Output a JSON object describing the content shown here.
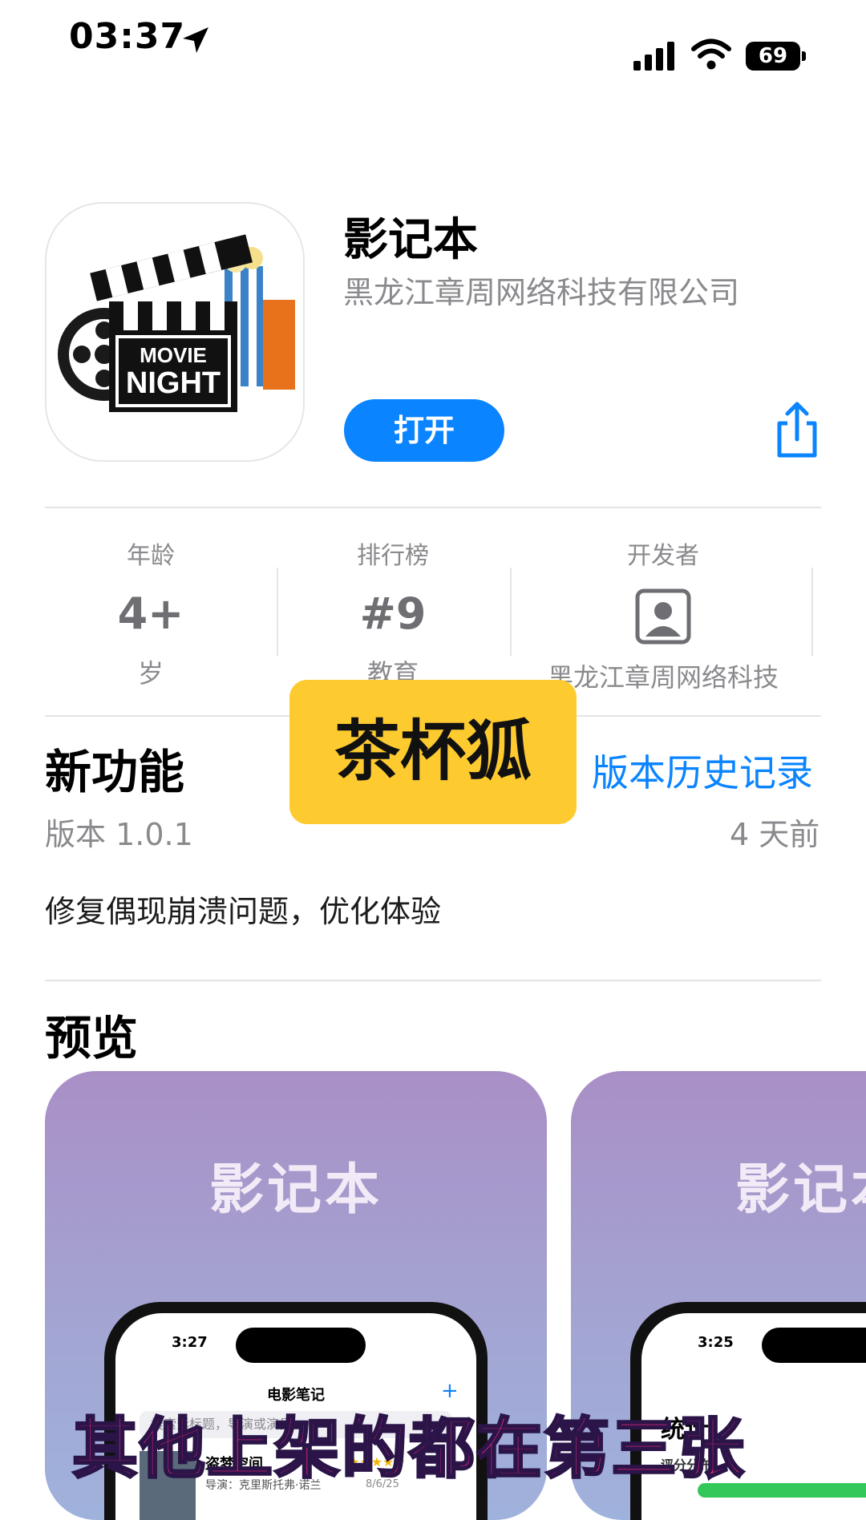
{
  "status_bar": {
    "time": "03:37",
    "battery": "69"
  },
  "app": {
    "title": "影记本",
    "developer": "黑龙江章周网络科技有限公司",
    "open_label": "打开",
    "icon_text_line1": "MOVIE",
    "icon_text_line2": "NIGHT"
  },
  "info": {
    "age": {
      "label": "年龄",
      "value": "4+",
      "sub": "岁"
    },
    "chart": {
      "label": "排行榜",
      "value": "#9",
      "sub": "教育"
    },
    "developer": {
      "label": "开发者",
      "sub": "黑龙江章周网络科技"
    }
  },
  "whats_new": {
    "title": "新功能",
    "history_link": "版本历史记录",
    "version": "版本 1.0.1",
    "date": "4 天前",
    "notes": "修复偶现崩溃问题，优化体验"
  },
  "preview": {
    "title": "预览",
    "screenshots": [
      {
        "title": "影记本",
        "phone_time": "3:27",
        "nav_title": "电影笔记",
        "search_placeholder": "搜索影标题，导演或演员",
        "movie_title": "盗梦空间",
        "movie_director": "导演：克里斯托弗·诺兰",
        "movie_date": "8/6/25"
      },
      {
        "title": "影记本",
        "phone_time": "3:25",
        "nav_title": "统计",
        "section": "评分分布"
      }
    ]
  },
  "overlays": {
    "sticker": "茶杯狐",
    "caption": "其他上架的都在第三张"
  },
  "colors": {
    "accent": "#0a84ff",
    "sticker": "#fdca2f",
    "caption": "#f0257c"
  }
}
